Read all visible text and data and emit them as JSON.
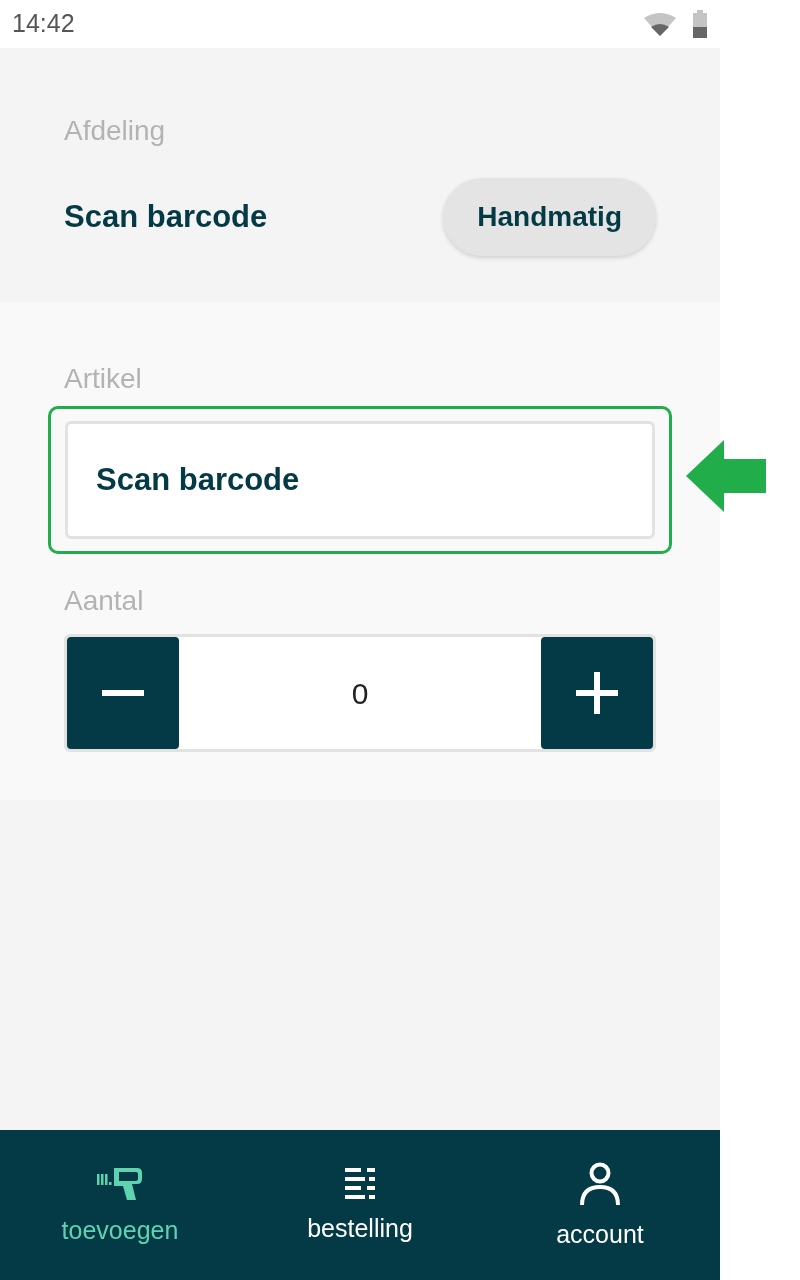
{
  "status_bar": {
    "time": "14:42"
  },
  "department": {
    "label": "Afdeling",
    "action_text": "Scan barcode",
    "button": "Handmatig"
  },
  "article": {
    "label": "Artikel",
    "field_value": "Scan barcode",
    "highlighted": true
  },
  "quantity": {
    "label": "Aantal",
    "value": "0"
  },
  "bottom_nav": [
    {
      "kind": "scanner",
      "label": "toevoegen",
      "selected": true
    },
    {
      "kind": "list",
      "label": "bestelling",
      "selected": false
    },
    {
      "kind": "person",
      "label": "account",
      "selected": false
    }
  ]
}
